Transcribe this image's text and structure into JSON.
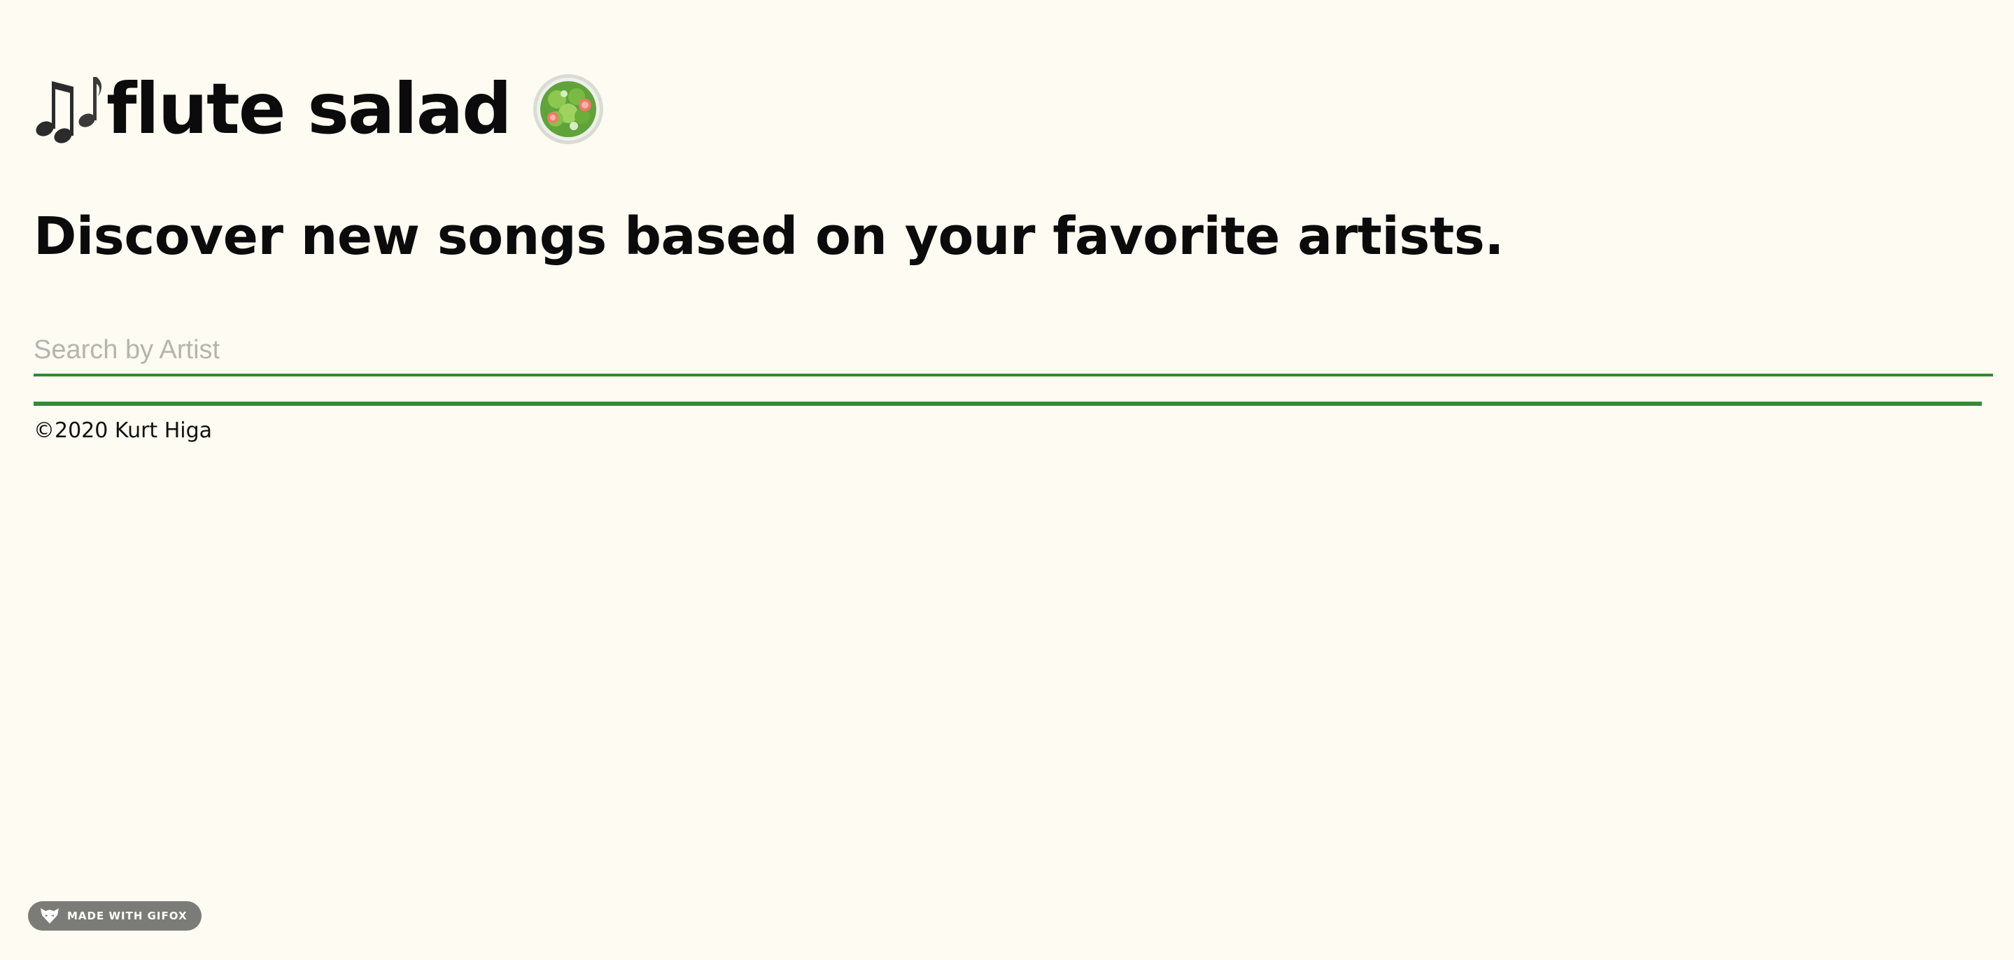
{
  "header": {
    "notes_icon": "musical-notes-icon",
    "title": "flute salad",
    "salad_icon": "green-salad-icon"
  },
  "main": {
    "tagline": "Discover new songs based on your favorite artists.",
    "search": {
      "placeholder": "Search by Artist",
      "value": ""
    }
  },
  "footer": {
    "copyright": "©2020 Kurt Higa"
  },
  "overlay": {
    "badge_label": "MADE WITH GIFOX",
    "badge_icon": "fox-icon"
  },
  "colors": {
    "background": "#fdfbf2",
    "accent": "#2e8b2e",
    "text": "#0b0b0b",
    "placeholder": "#b5b5b0"
  }
}
